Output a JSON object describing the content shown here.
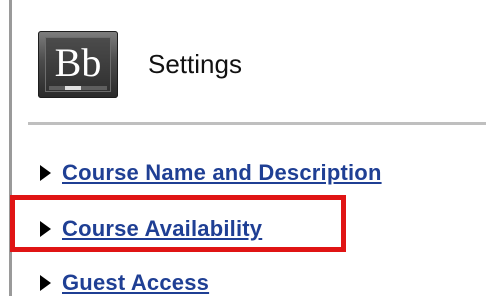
{
  "logo": {
    "text": "Bb"
  },
  "header": {
    "title": "Settings"
  },
  "links": [
    {
      "label": "Course Name and Description"
    },
    {
      "label": "Course Availability"
    },
    {
      "label": "Guest Access"
    }
  ],
  "colors": {
    "link": "#1f3f94",
    "highlight": "#e01414",
    "divider": "#bfbfbf"
  }
}
